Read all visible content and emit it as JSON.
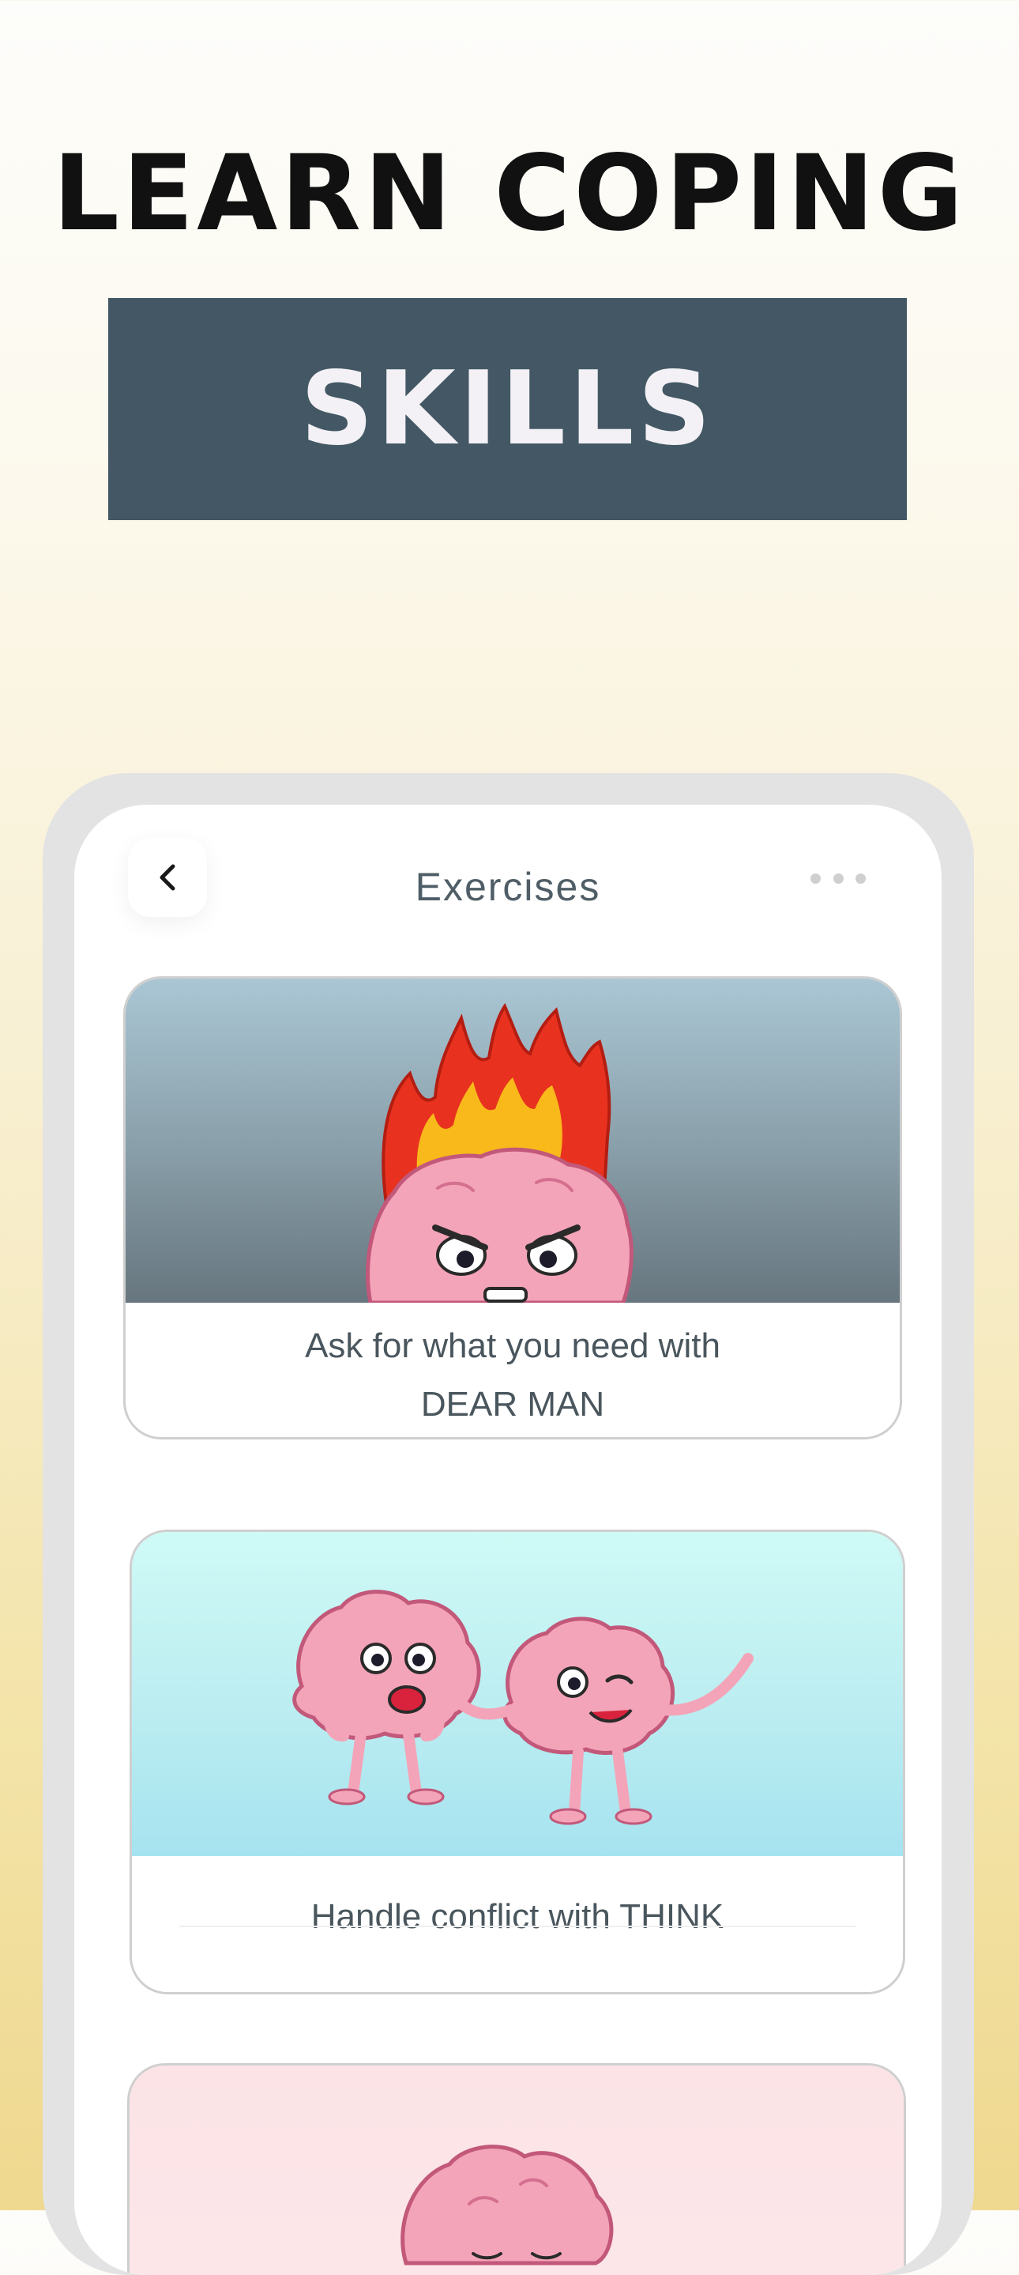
{
  "promo": {
    "headline": "LEARN COPING",
    "banner": "SKILLS"
  },
  "nav": {
    "title": "Exercises",
    "back_icon": "chevron-left-icon",
    "more_icon": "more-horizontal-icon"
  },
  "cards": [
    {
      "caption_line1": "Ask for what you need with",
      "caption_line2": "DEAR MAN",
      "art": "angry-brain-on-fire"
    },
    {
      "caption": "Handle conflict with THINK",
      "art": "two-brains-waving"
    },
    {
      "art": "calm-brain"
    }
  ],
  "colors": {
    "banner_bg": "#435864",
    "banner_text": "#f3f1f6",
    "title_text": "#4f5e66",
    "brain_pink": "#f4a4b8"
  }
}
